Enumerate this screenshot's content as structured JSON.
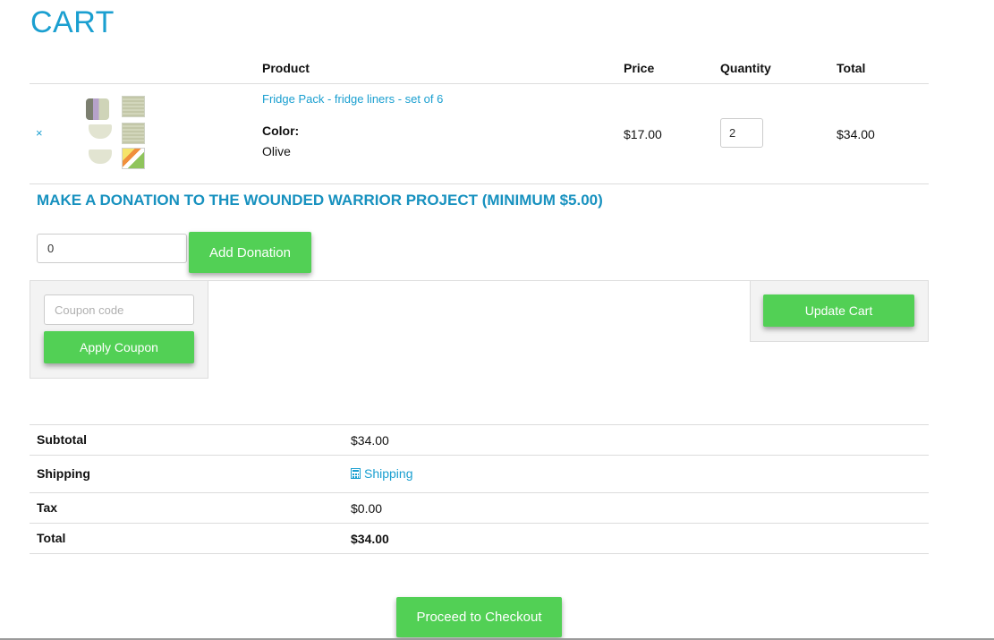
{
  "page": {
    "title": "CART"
  },
  "cart_table": {
    "headers": {
      "product": "Product",
      "price": "Price",
      "quantity": "Quantity",
      "total": "Total"
    },
    "items": [
      {
        "remove_symbol": "×",
        "name": "Fridge Pack - fridge liners - set of 6",
        "attribute_label": "Color:",
        "attribute_value": "Olive",
        "price": "$17.00",
        "quantity": "2",
        "total": "$34.00"
      }
    ]
  },
  "donation": {
    "heading": "MAKE A DONATION TO THE WOUNDED WARRIOR PROJECT (MINIMUM $5.00)",
    "amount": "0",
    "button_label": "Add Donation"
  },
  "coupon": {
    "placeholder": "Coupon code",
    "button_label": "Apply Coupon"
  },
  "update_cart": {
    "button_label": "Update Cart"
  },
  "totals": {
    "subtotal_label": "Subtotal",
    "subtotal_value": "$34.00",
    "shipping_label": "Shipping",
    "shipping_value": "Shipping",
    "shipping_icon": "calculator-icon",
    "tax_label": "Tax",
    "tax_value": "$0.00",
    "total_label": "Total",
    "total_value": "$34.00"
  },
  "checkout": {
    "button_label": "Proceed to Checkout"
  },
  "colors": {
    "accent": "#1a9fd0",
    "button_green": "#52d055",
    "panel_bg": "#f3f3f3"
  }
}
